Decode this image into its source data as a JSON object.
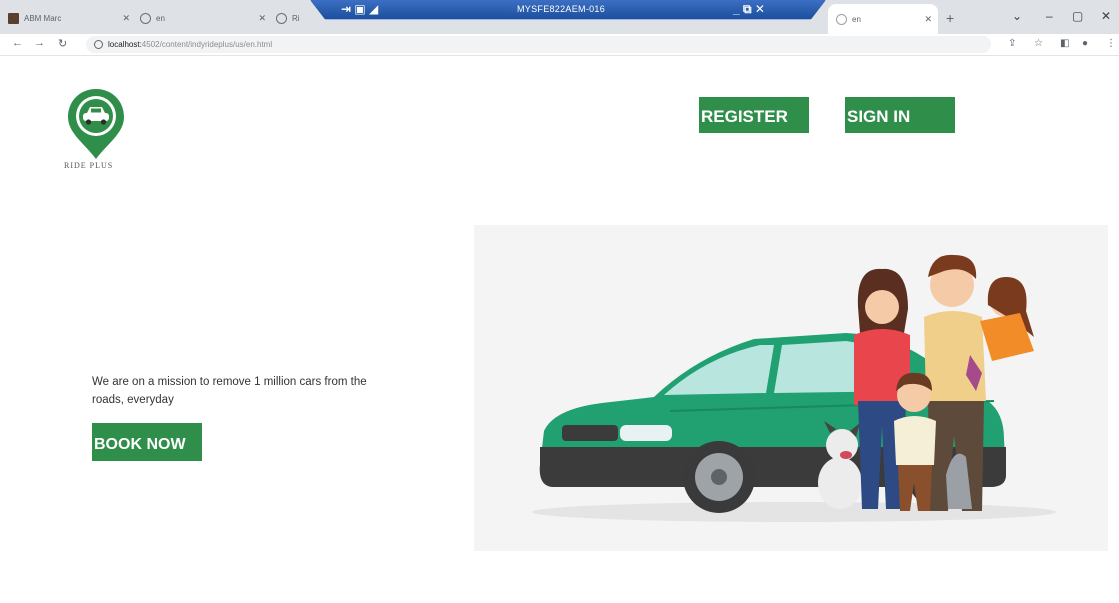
{
  "browser": {
    "tabs": [
      {
        "label": "ABM Marc"
      },
      {
        "label": "en"
      },
      {
        "label": "Ri"
      },
      {
        "label": "en",
        "active": true
      }
    ],
    "remote_session_title": "MYSFE822AEM-016",
    "url_host": "localhost:",
    "url_path": "4502/content/indyrideplus/us/en.html"
  },
  "page": {
    "brand": "RIDE PLUS",
    "brand_color": "#2f8f4a",
    "nav": {
      "register_label": "REGISTER",
      "signin_label": "SIGN IN"
    },
    "hero": {
      "tagline": "We are on a mission to remove 1 million cars from the roads, everyday",
      "cta_label": "BOOK NOW"
    }
  },
  "icons": [
    "car-pin-logo-icon",
    "back-icon",
    "forward-icon",
    "reload-icon",
    "info-icon",
    "share-icon",
    "star-icon",
    "sidebar-icon",
    "profile-icon",
    "menu-icon"
  ]
}
